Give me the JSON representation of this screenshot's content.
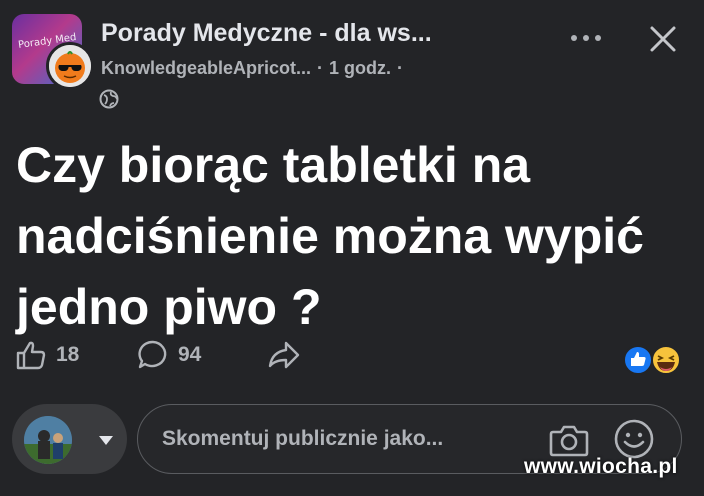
{
  "header": {
    "group_avatar_text": "Porady Med",
    "group_name": "Porady Medyczne - dla ws...",
    "author": "KnowledgeableApricot...",
    "separator": "·",
    "time": "1 godz.",
    "separator_after": "·",
    "privacy_icon": "globe-icon"
  },
  "post": {
    "text": "Czy biorąc tabletki na nadciśnienie można wypić jedno piwo ?"
  },
  "actions": {
    "like_icon": "thumbs-up-icon",
    "like_count": "18",
    "comment_icon": "comment-bubble-icon",
    "comment_count": "94",
    "share_icon": "share-arrow-icon"
  },
  "reactions": [
    "like-reaction-icon",
    "haha-reaction-icon"
  ],
  "composer": {
    "placeholder": "Skomentuj publicznie jako...",
    "camera_icon": "camera-icon",
    "emoji_icon": "smiley-icon"
  },
  "watermark": "www.wiocha.pl",
  "colors": {
    "background": "#232427",
    "text_primary": "#e4e6eb",
    "text_secondary": "#b0b3b8",
    "like_blue": "#1877f2"
  }
}
